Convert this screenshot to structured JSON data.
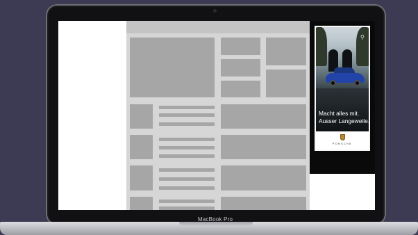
{
  "device": {
    "label": "MacBook Pro"
  },
  "ad": {
    "headline_line1": "Macht alles mit.",
    "headline_line2": "Ausser Langeweile.",
    "brand": "PORSCHE",
    "icon": "bicycle-icon"
  },
  "colors": {
    "background": "#3d3b54",
    "placeholder_block": "#a6a6a6",
    "placeholder_bg": "#d6d6d6",
    "car": "#2243a8",
    "crest": "#b58a2e"
  }
}
